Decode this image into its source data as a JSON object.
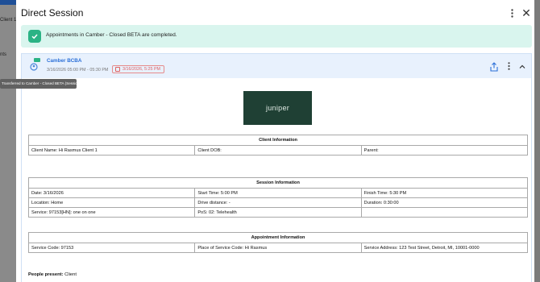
{
  "background": {
    "sidebar_texts": [
      "amberp",
      "Client 1",
      "nts"
    ],
    "tooltip": "Transferred to Camber - Closed BETA (Session)"
  },
  "dialog": {
    "title": "Direct Session",
    "alert_text": "Appointments in Camber - Closed BETA are completed."
  },
  "session_header": {
    "name": "Camber BCBA",
    "avatar_initials": "CB",
    "time_range": "3/16/2026 05:00 PM - 05:30 PM",
    "signed_date": "3/16/2026, 5:25 PM"
  },
  "logo_text": "juniper",
  "client_info": {
    "title": "Client Information",
    "client_name": "Client Name: Hi Rasmus Client 1",
    "client_dob": "Client DOB:",
    "parent": "Parent:"
  },
  "session_info": {
    "title": "Session Information",
    "rows": [
      [
        "Date: 3/16/2026",
        "Start Time: 5:00 PM",
        "Finish Time: 5:30 PM"
      ],
      [
        "Location: Home",
        "Drive distance: -",
        "Duration: 0:30:00"
      ],
      [
        "Service: 97153[HN]: one on one",
        "PoS: 02: Telehealth",
        ""
      ]
    ]
  },
  "appointment_info": {
    "title": "Appointment Information",
    "service_code": "Service Code: 97153",
    "place_of_service": "Place of Service Code: Hi Rasmus",
    "service_address": "Service Address: 123 Test Street, Detroit, MI, 10001-0000"
  },
  "people_present": {
    "label": "People present:",
    "value": "Client"
  },
  "colors": {
    "accent": "#2a6fd8",
    "success": "#2bb385",
    "alert_bg": "#d9f5ee",
    "warning": "#e06060",
    "logo_bg": "#1f4034"
  }
}
